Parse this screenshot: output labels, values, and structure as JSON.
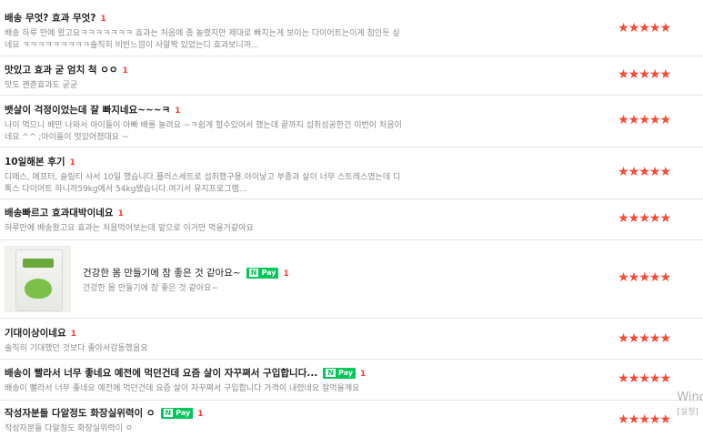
{
  "reviews": [
    {
      "title": "배송 무엇? 효과 무엇?",
      "count": "1",
      "body": "배송 하루 만에 왔고요ㅋㅋㅋㅋㅋㅋㅋ 효과는 처음에 좀 놀랬지만 제대로 빠지는게 보이는 다이어트는이게 첨인듯 싶네요 ㅋㅋㅋㅋㅋㅋㅋㅋㅋ솔직히 비빈느낌이 사알짝 있었는디 효과보니까...",
      "rating": "★★★★★"
    },
    {
      "title": "맛있고 효과 굳 엄치 척 ㅇㅇ",
      "count": "1",
      "body": "맛도 괜춘효과도 굳굳",
      "rating": "★★★★★"
    },
    {
      "title": "뱃살이 걱정이었는데 잘 빠지네요~~~ㅋ",
      "count": "1",
      "body": "나이 먹으니 배만 나와서 아이들이 아빠 배를 놀려요 ~ㅋ쉽게 할수있어서 했는데 끝까지 섭취성공한건 이번이 처음이네요 ^^ ;아이들이 멋있어졌대요 ~",
      "rating": "★★★★★"
    },
    {
      "title": "10일해본 후기",
      "count": "1",
      "body": "디에스, 에프터, 슬림티 사서 10일 했습니다.플러스세트로 섭취했구용.아이낳고 부종과 살이 너무 스트레스였는데 디톡스 다이어트 하니까59kg에서 54kg됐습니다.여기서 유지프로그램...",
      "rating": "★★★★★"
    },
    {
      "title": "배송빠르고 효과대박이네요",
      "count": "1",
      "body": "하루만에 배송왔고요 효과는 처음먹어보는데 앞으로 이거만 먹을거같아요",
      "rating": "★★★★★"
    },
    {
      "title": "건강한 몸 만들기에 참 좋은 것 같아요~",
      "count": "1",
      "body": "건강한 몸 만들기에 참 좋은 것 같아요~",
      "rating": "★★★★★",
      "npay": true,
      "photo": true
    },
    {
      "title": "기대이상이네요",
      "count": "1",
      "body": "솔직히 기대했던 것보다 좋아서감동했음요",
      "rating": "★★★★★"
    },
    {
      "title": "배송이 빨라서 너무 좋네요 예전에 먹던건데 요즘 살이 자꾸쪄서 구입합니다...",
      "count": "1",
      "body": "배송이 빨라서 너무 좋네요 예전에 먹던건데 요즘 살이 자꾸쪄서 구입합니다 가격이 내렸네요 잘먹을께요",
      "rating": "★★★★★",
      "npay": true
    },
    {
      "title": "작성자분들 다알정도 화장실위력이 ㅇ",
      "count": "1",
      "body": "작성자분들 다알정도 화장실위력이 ㅇ",
      "rating": "★★★★★",
      "npay": true
    }
  ],
  "npay_label": {
    "n": "N",
    "pay": "Pay"
  },
  "watermark": {
    "line1": "Wind",
    "line2": "[설정]"
  },
  "colors": {
    "star": "#ff4633",
    "npay": "#03c75a",
    "count": "#ff3b30"
  }
}
